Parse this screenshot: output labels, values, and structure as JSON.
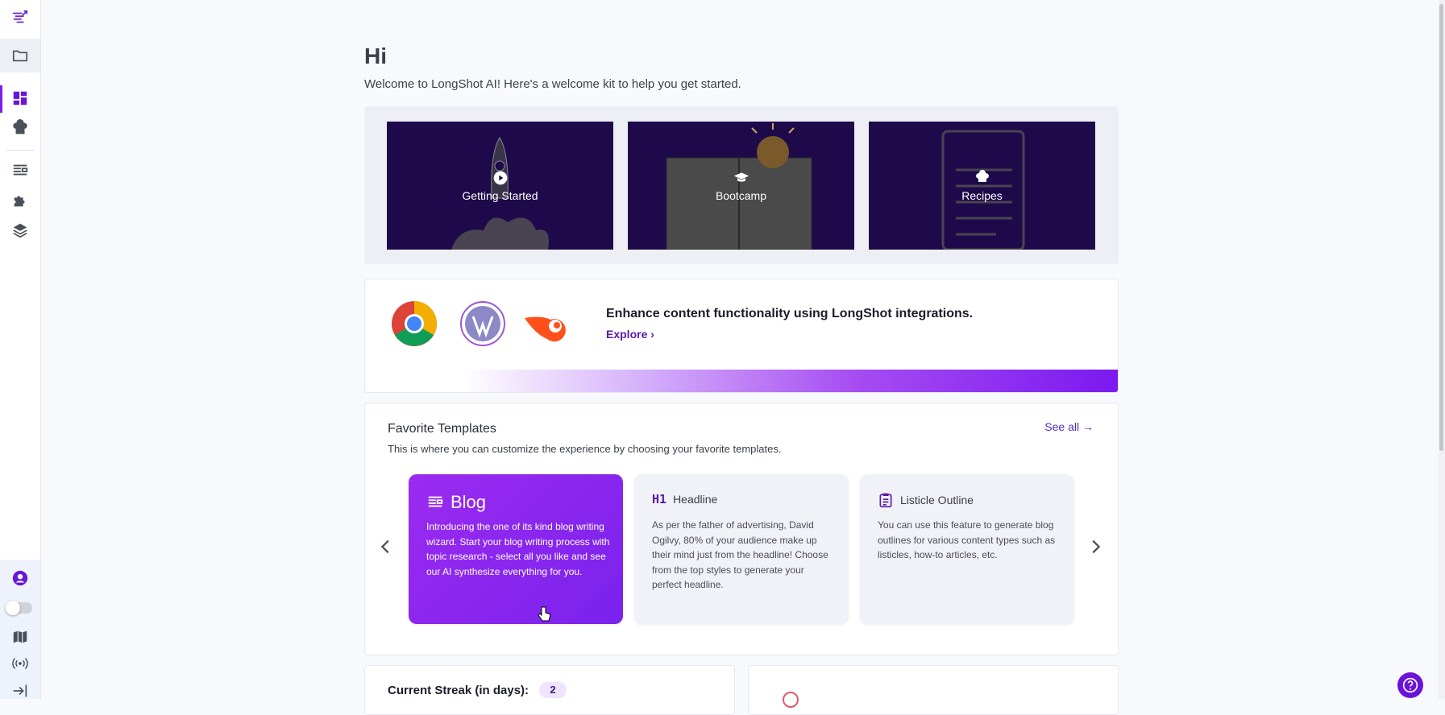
{
  "greeting": "Hi",
  "welcome_text": "Welcome to LongShot AI! Here's a welcome kit to help you get started.",
  "welcome_kit": [
    {
      "label": "Getting Started",
      "icon": "play-icon"
    },
    {
      "label": "Bootcamp",
      "icon": "graduation-cap-icon"
    },
    {
      "label": "Recipes",
      "icon": "chef-hat-icon"
    }
  ],
  "integrations": {
    "title": "Enhance content functionality using LongShot integrations.",
    "link_label": "Explore",
    "logos": [
      "chrome-logo",
      "wordpress-logo",
      "semrush-logo"
    ]
  },
  "favorites": {
    "title": "Favorite Templates",
    "subtitle": "This is where you can customize the experience by choosing your favorite templates.",
    "see_all": "See all",
    "templates": [
      {
        "name": "Blog",
        "icon": "blog-icon",
        "description": "Introducing the one of its kind blog writing wizard. Start your blog writing process with topic research - select all you like and see our AI synthesize everything for you."
      },
      {
        "name": "Headline",
        "icon": "h1-icon",
        "description": "As per the father of advertising, David Ogilvy, 80% of your audience make up their mind just from the headline! Choose from the top styles to generate your perfect headline."
      },
      {
        "name": "Listicle Outline",
        "icon": "clipboard-icon",
        "description": "You can use this feature to generate blog outlines for various content types such as listicles, how-to articles, etc."
      }
    ]
  },
  "streak": {
    "label": "Current Streak (in days):",
    "value": "2"
  },
  "colors": {
    "accent": "#7c1fe6",
    "kit_bg": "#1e0a4a",
    "help": "#6b12d9"
  },
  "sidebar_icons": [
    "logo-icon",
    "folder-icon",
    "dashboard-icon",
    "chef-hat-icon",
    "document-icon",
    "puzzle-icon",
    "layers-icon",
    "user-icon",
    "map-icon",
    "broadcast-icon",
    "collapse-icon"
  ]
}
